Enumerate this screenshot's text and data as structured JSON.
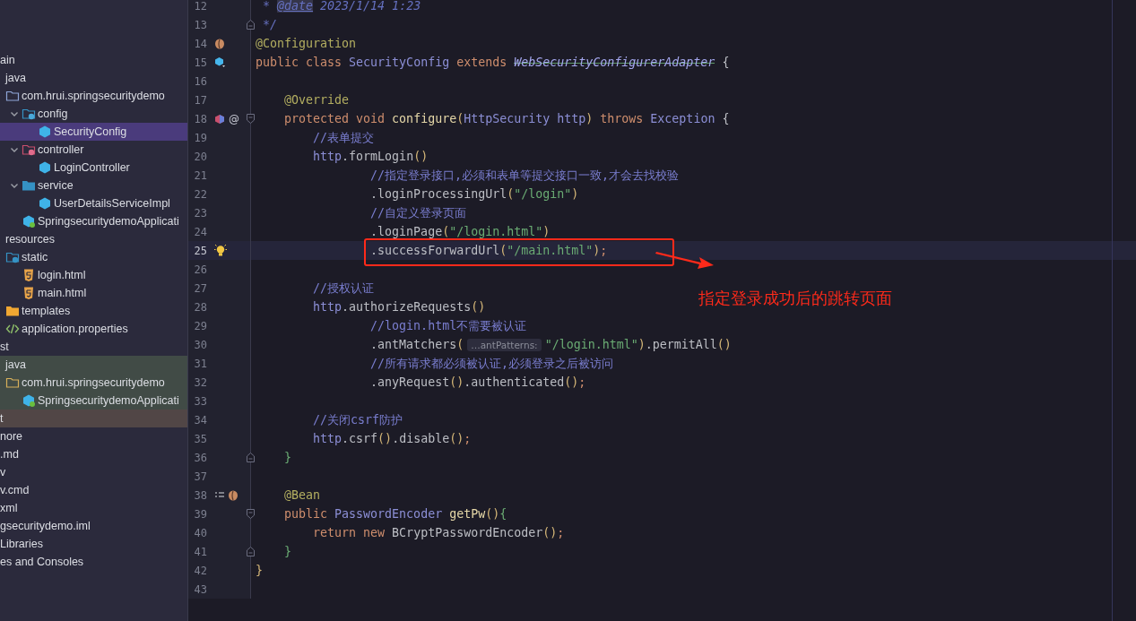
{
  "project_tree": [
    {
      "label": "ain",
      "children": [
        {
          "label": "java",
          "children": [
            {
              "label": "com.hrui.springsecuritydemo",
              "kind": "package",
              "children": [
                {
                  "label": "config",
                  "kind": "config-package",
                  "expanded": true,
                  "children": [
                    {
                      "label": "SecurityConfig",
                      "kind": "class",
                      "selected": true
                    }
                  ]
                },
                {
                  "label": "controller",
                  "kind": "controller-package",
                  "expanded": true,
                  "children": [
                    {
                      "label": "LoginController",
                      "kind": "class",
                      "selected": false
                    }
                  ]
                },
                {
                  "label": "service",
                  "kind": "service-package",
                  "expanded": true,
                  "children": [
                    {
                      "label": "UserDetailsServiceImpl",
                      "kind": "class",
                      "selected": false
                    }
                  ]
                },
                {
                  "label": "SpringsecuritydemoApplicati",
                  "kind": "spring-class",
                  "selected": false
                }
              ]
            }
          ]
        },
        {
          "label": "resources",
          "children": [
            {
              "label": "static",
              "kind": "web-folder",
              "children": [
                {
                  "label": "login.html",
                  "kind": "html",
                  "selected": false
                },
                {
                  "label": "main.html",
                  "kind": "html",
                  "selected": false
                }
              ]
            },
            {
              "label": "templates",
              "kind": "templates-folder"
            },
            {
              "label": "application.properties",
              "kind": "properties",
              "selected": false
            }
          ]
        }
      ]
    },
    {
      "label": "st",
      "children": [
        {
          "label": "java",
          "kind": "test-root",
          "children": [
            {
              "label": "com.hrui.springsecuritydemo",
              "kind": "test-package",
              "children": [
                {
                  "label": "SpringsecuritydemoApplicati",
                  "kind": "test-class",
                  "selected": false
                }
              ]
            }
          ]
        }
      ]
    },
    {
      "label": "t",
      "kind": "excluded"
    },
    {
      "label": "nore"
    },
    {
      "label": ".md"
    },
    {
      "label": "v"
    },
    {
      "label": "v.cmd"
    },
    {
      "label": "xml"
    },
    {
      "label": "gsecuritydemo.iml"
    },
    {
      "label": " Libraries"
    },
    {
      "label": "es and Consoles"
    }
  ],
  "editor": {
    "lines": [
      {
        "number": "12",
        "current": false,
        "tokens": [
          {
            "kind": "doc",
            "text": " * "
          },
          {
            "kind": "doctag",
            "text": "@date"
          },
          {
            "kind": "doc",
            "text": " 2023/1/14 1:23"
          }
        ]
      },
      {
        "number": "13",
        "current": false,
        "markers": [
          {
            "kind": "fold-end"
          }
        ],
        "tokens": [
          {
            "kind": "doc",
            "text": " */"
          }
        ]
      },
      {
        "number": "14",
        "current": false,
        "markers": [
          {
            "kind": "bean"
          }
        ],
        "tokens": [
          {
            "kind": "annotation",
            "text": "@Configuration"
          }
        ]
      },
      {
        "number": "15",
        "current": false,
        "markers": [
          {
            "kind": "cube"
          }
        ],
        "tokens": [
          {
            "kind": "keyword",
            "text": "public class "
          },
          {
            "kind": "type",
            "text": "SecurityConfig "
          },
          {
            "kind": "keyword",
            "text": "extends "
          },
          {
            "kind": "deprecated",
            "text": "WebSecurityConfigurerAdapter"
          },
          {
            "kind": "plain",
            "text": " {"
          }
        ]
      },
      {
        "number": "16",
        "current": false
      },
      {
        "number": "17",
        "current": false,
        "tokens": [
          {
            "kind": "annotation",
            "text": "    @Override"
          }
        ]
      },
      {
        "number": "18",
        "current": false,
        "markers": [
          {
            "kind": "override"
          },
          {
            "kind": "glyph",
            "text": "@"
          },
          {
            "kind": "fold-start"
          }
        ],
        "tokens": [
          {
            "kind": "keyword",
            "text": "    protected void "
          },
          {
            "kind": "method",
            "text": "configure"
          },
          {
            "kind": "paren",
            "text": "("
          },
          {
            "kind": "type",
            "text": "HttpSecurity http"
          },
          {
            "kind": "paren",
            "text": ")"
          },
          {
            "kind": "keyword",
            "text": " throws "
          },
          {
            "kind": "type",
            "text": "Exception"
          },
          {
            "kind": "plain",
            "text": " {"
          }
        ]
      },
      {
        "number": "19",
        "current": false,
        "tokens": [
          {
            "kind": "comment",
            "text": "        //表单提交"
          }
        ]
      },
      {
        "number": "20",
        "current": false,
        "tokens": [
          {
            "kind": "type",
            "text": "        http"
          },
          {
            "kind": "plain",
            "text": ".formLogin"
          },
          {
            "kind": "paren",
            "text": "()"
          }
        ]
      },
      {
        "number": "21",
        "current": false,
        "tokens": [
          {
            "kind": "comment",
            "text": "                //指定登录接口,必须和表单等提交接口一致,才会去找校验"
          }
        ]
      },
      {
        "number": "22",
        "current": false,
        "tokens": [
          {
            "kind": "plain",
            "text": "                .loginProcessingUrl"
          },
          {
            "kind": "paren",
            "text": "("
          },
          {
            "kind": "string",
            "text": "\"/login\""
          },
          {
            "kind": "paren",
            "text": ")"
          }
        ]
      },
      {
        "number": "23",
        "current": false,
        "tokens": [
          {
            "kind": "comment",
            "text": "                //自定义登录页面"
          }
        ]
      },
      {
        "number": "24",
        "current": false,
        "tokens": [
          {
            "kind": "plain",
            "text": "                .loginPage"
          },
          {
            "kind": "paren",
            "text": "("
          },
          {
            "kind": "string",
            "text": "\"/login.html\""
          },
          {
            "kind": "paren",
            "text": ")"
          }
        ]
      },
      {
        "number": "25",
        "current": true,
        "markers": [
          {
            "kind": "bulb"
          }
        ],
        "tokens": [
          {
            "kind": "plain",
            "text": "                .successForwardUrl"
          },
          {
            "kind": "paren",
            "text": "("
          },
          {
            "kind": "string",
            "text": "\"/main.html\""
          },
          {
            "kind": "paren",
            "text": ")"
          },
          {
            "kind": "keyword",
            "text": ";"
          }
        ]
      },
      {
        "number": "26",
        "current": false
      },
      {
        "number": "27",
        "current": false,
        "tokens": [
          {
            "kind": "comment",
            "text": "        //授权认证"
          }
        ]
      },
      {
        "number": "28",
        "current": false,
        "tokens": [
          {
            "kind": "type",
            "text": "        http"
          },
          {
            "kind": "plain",
            "text": ".authorizeRequests"
          },
          {
            "kind": "paren",
            "text": "()"
          }
        ]
      },
      {
        "number": "29",
        "current": false,
        "tokens": [
          {
            "kind": "comment",
            "text": "                //login.html不需要被认证"
          }
        ]
      },
      {
        "number": "30",
        "current": false,
        "tokens": [
          {
            "kind": "plain",
            "text": "                .antMatchers"
          },
          {
            "kind": "paren",
            "text": "("
          },
          {
            "kind": "hint",
            "text": "…antPatterns:"
          },
          {
            "kind": "string",
            "text": "\"/login.html\""
          },
          {
            "kind": "paren",
            "text": ")"
          },
          {
            "kind": "plain",
            "text": ".permitAll"
          },
          {
            "kind": "paren",
            "text": "()"
          }
        ]
      },
      {
        "number": "31",
        "current": false,
        "tokens": [
          {
            "kind": "comment",
            "text": "                //所有请求都必须被认证,必须登录之后被访问"
          }
        ]
      },
      {
        "number": "32",
        "current": false,
        "tokens": [
          {
            "kind": "plain",
            "text": "                .anyRequest"
          },
          {
            "kind": "paren",
            "text": "()"
          },
          {
            "kind": "plain",
            "text": ".authenticated"
          },
          {
            "kind": "paren",
            "text": "()"
          },
          {
            "kind": "keyword",
            "text": ";"
          }
        ]
      },
      {
        "number": "33",
        "current": false
      },
      {
        "number": "34",
        "current": false,
        "tokens": [
          {
            "kind": "comment",
            "text": "        //关闭csrf防护"
          }
        ]
      },
      {
        "number": "35",
        "current": false,
        "tokens": [
          {
            "kind": "type",
            "text": "        http"
          },
          {
            "kind": "plain",
            "text": ".csrf"
          },
          {
            "kind": "paren",
            "text": "()"
          },
          {
            "kind": "plain",
            "text": ".disable"
          },
          {
            "kind": "paren",
            "text": "()"
          },
          {
            "kind": "keyword",
            "text": ";"
          }
        ]
      },
      {
        "number": "36",
        "current": false,
        "markers": [
          {
            "kind": "fold-end"
          }
        ],
        "tokens": [
          {
            "kind": "brace",
            "text": "    }"
          }
        ]
      },
      {
        "number": "37",
        "current": false
      },
      {
        "number": "38",
        "current": false,
        "markers": [
          {
            "kind": "list"
          },
          {
            "kind": "bean"
          }
        ],
        "tokens": [
          {
            "kind": "annotation",
            "text": "    @Bean"
          }
        ]
      },
      {
        "number": "39",
        "current": false,
        "markers": [
          {
            "kind": "fold-start"
          }
        ],
        "tokens": [
          {
            "kind": "keyword",
            "text": "    public "
          },
          {
            "kind": "type",
            "text": "PasswordEncoder "
          },
          {
            "kind": "method",
            "text": "getPw"
          },
          {
            "kind": "paren",
            "text": "()"
          },
          {
            "kind": "brace",
            "text": "{"
          }
        ]
      },
      {
        "number": "40",
        "current": false,
        "tokens": [
          {
            "kind": "keyword",
            "text": "        return new "
          },
          {
            "kind": "plain",
            "text": "BCryptPasswordEncoder"
          },
          {
            "kind": "paren",
            "text": "()"
          },
          {
            "kind": "keyword",
            "text": ";"
          }
        ]
      },
      {
        "number": "41",
        "current": false,
        "markers": [
          {
            "kind": "fold-end"
          }
        ],
        "tokens": [
          {
            "kind": "brace",
            "text": "    }"
          }
        ]
      },
      {
        "number": "42",
        "current": false,
        "tokens": [
          {
            "kind": "paren",
            "text": "}"
          }
        ]
      },
      {
        "number": "43",
        "current": false
      }
    ]
  },
  "callout": {
    "text": "指定登录成功后的跳转页面"
  }
}
